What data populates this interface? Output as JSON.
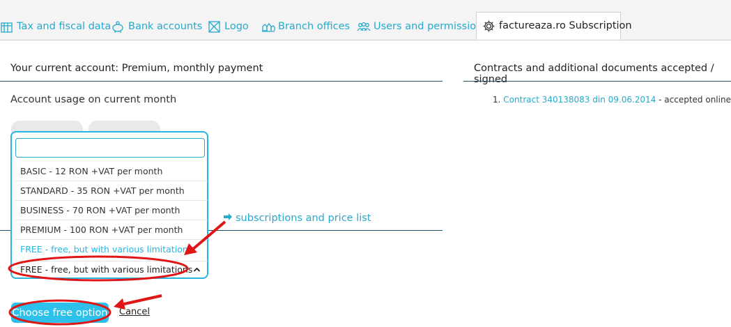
{
  "tabs": [
    {
      "label": "Tax and fiscal data",
      "icon": "building-icon"
    },
    {
      "label": "Bank accounts",
      "icon": "piggy-bank-icon"
    },
    {
      "label": "Logo",
      "icon": "logo-icon"
    },
    {
      "label": "Branch offices",
      "icon": "branch-offices-icon"
    },
    {
      "label": "Users and permission",
      "icon": "users-icon"
    },
    {
      "label": "factureaza.ro Subscription",
      "icon": "gear-icon",
      "active": true
    }
  ],
  "account": {
    "title": "Your current account: Premium, monthly payment",
    "usage_label": "Account usage on current month"
  },
  "plan_dropdown": {
    "search_value": "",
    "options": [
      "BASIC - 12 RON +VAT per month",
      "STANDARD - 35 RON +VAT per month",
      "BUSINESS - 70 RON +VAT per month",
      "PREMIUM - 100 RON +VAT per month",
      "FREE - free, but with various limitations"
    ],
    "highlighted_index": 4,
    "selected": "FREE - free, but with various limitations"
  },
  "price_link": "subscriptions and price list",
  "actions": {
    "choose_free": "Choose free option",
    "cancel": "Cancel"
  },
  "contracts": {
    "title": "Contracts and additional documents accepted / signed",
    "items": [
      {
        "number": "1.",
        "link": "Contract 340138083 din 09.06.2014",
        "suffix": " - accepted online by Pe"
      }
    ]
  },
  "colors": {
    "accent": "#26a9cc",
    "button": "#2cc0ea",
    "annotation": "#e01515"
  }
}
